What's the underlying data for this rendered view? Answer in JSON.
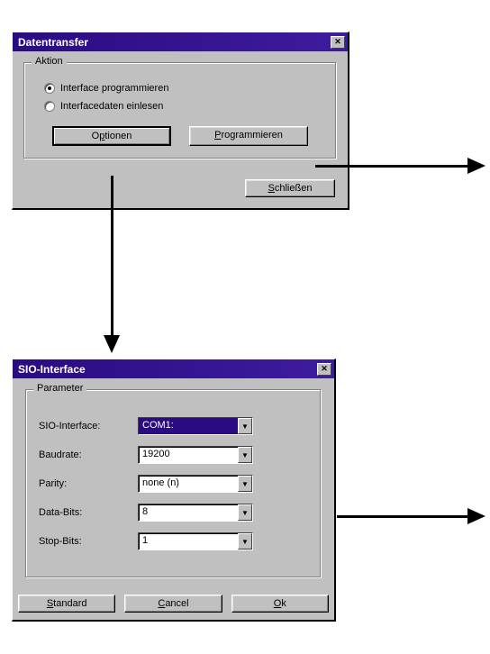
{
  "dialog1": {
    "title": "Datentransfer",
    "group": {
      "legend": "Aktion",
      "radio1": "Interface programmieren",
      "radio2": "Interfacedaten einlesen"
    },
    "options_btn_pre": "O",
    "options_btn_ul": "p",
    "options_btn_post": "tionen",
    "program_btn_pre": "",
    "program_btn_ul": "P",
    "program_btn_post": "rogrammieren",
    "close_btn_pre": "",
    "close_btn_ul": "S",
    "close_btn_post": "chließen"
  },
  "dialog2": {
    "title": "SIO-Interface",
    "group_legend": "Parameter",
    "labels": {
      "sio": "SIO-Interface:",
      "baud": "Baudrate:",
      "parity": "Parity:",
      "databits": "Data-Bits:",
      "stopbits": "Stop-Bits:"
    },
    "values": {
      "sio": "COM1:",
      "baud": "19200",
      "parity": "none (n)",
      "databits": "8",
      "stopbits": "1"
    },
    "standard_btn_pre": "",
    "standard_btn_ul": "S",
    "standard_btn_post": "tandard",
    "cancel_btn_pre": "",
    "cancel_btn_ul": "C",
    "cancel_btn_post": "ancel",
    "ok_btn_pre": "",
    "ok_btn_ul": "O",
    "ok_btn_post": "k"
  }
}
